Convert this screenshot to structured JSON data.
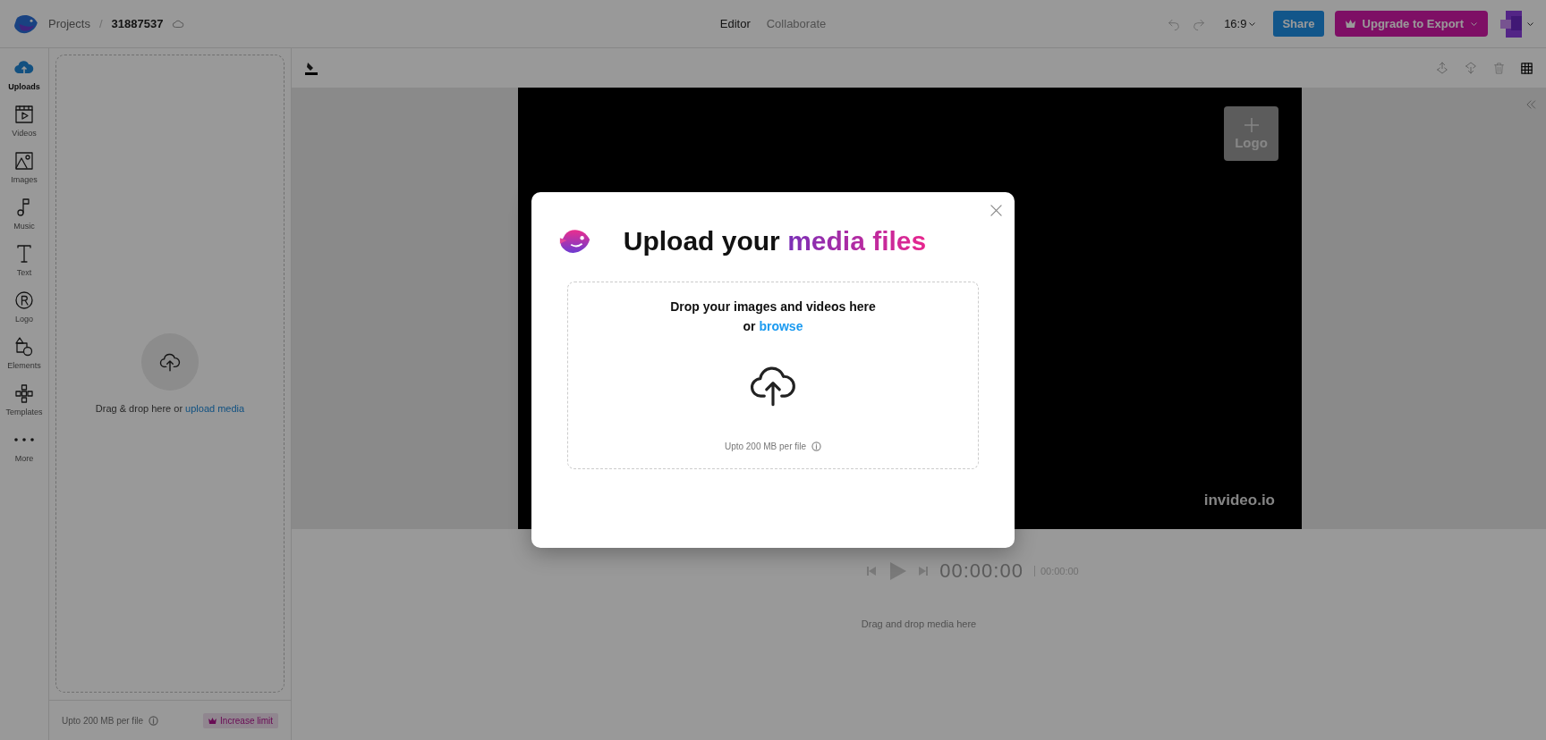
{
  "header": {
    "breadcrumb": [
      {
        "label": "Projects"
      },
      {
        "separator": "/",
        "label": "31887537"
      }
    ],
    "modes": [
      {
        "label": "Editor",
        "selected": true
      },
      {
        "label": "Collaborate",
        "selected": false
      }
    ],
    "aspect_ratio": "16:9",
    "share": "Share",
    "upgrade": "Upgrade to Export"
  },
  "sidebar": {
    "items": [
      {
        "label": "Uploads",
        "kind": "upload",
        "selected": true
      },
      {
        "label": "Videos",
        "kind": "video",
        "selected": false
      },
      {
        "label": "Images",
        "kind": "image",
        "selected": false
      },
      {
        "label": "Music",
        "kind": "music",
        "selected": false
      },
      {
        "label": "Text",
        "kind": "text",
        "selected": false
      },
      {
        "label": "Logo",
        "kind": "logo",
        "selected": false
      },
      {
        "label": "Elements",
        "kind": "elements",
        "selected": false
      },
      {
        "label": "Templates",
        "kind": "templates",
        "selected": false
      },
      {
        "label": "More",
        "kind": "more",
        "selected": false
      }
    ]
  },
  "panel": {
    "drop_text": "Drag & drop here or ",
    "link": "upload media",
    "limit": "Upto 200 MB per file",
    "increase": "Increase limit"
  },
  "canvas": {
    "logo_button": "Logo",
    "watermark": "invideo.io"
  },
  "player": {
    "time": "00:00:00",
    "duration": "00:00:00"
  },
  "timeline": {
    "hint": "Drag and drop media here"
  },
  "modal": {
    "title": "Upload your ",
    "title_highlight": "media files",
    "drop_text": "Drop your images and videos here",
    "or": "or ",
    "browse": "browse",
    "limit": "Upto 200 MB per file"
  }
}
